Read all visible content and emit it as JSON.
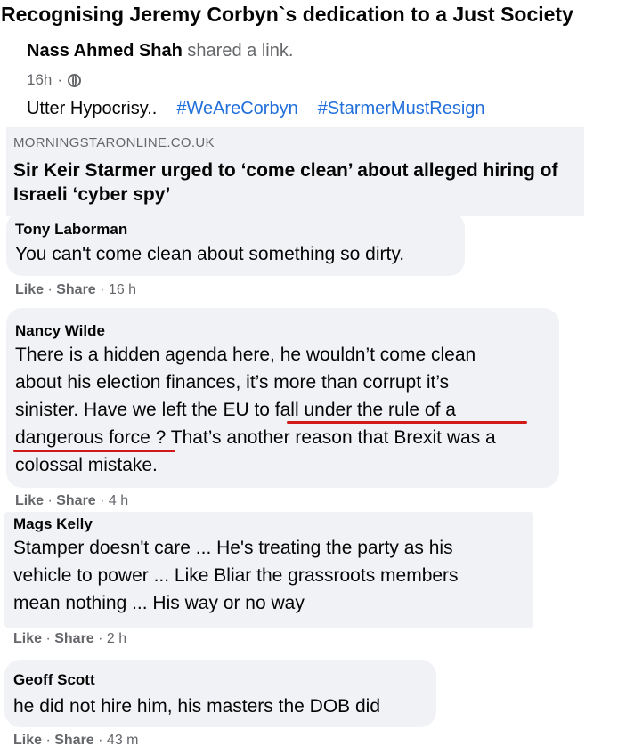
{
  "group": {
    "title": "Recognising Jeremy Corbyn`s dedication to a Just Society"
  },
  "post": {
    "author": "Nass Ahmed Shah",
    "action": " shared a link.",
    "time": "16h",
    "privacy_icon": "globe-icon",
    "text": "Utter Hypocrisy..",
    "hashtags": [
      "#WeAreCorbyn",
      "#StarmerMustResign"
    ],
    "link": {
      "domain": "MORNINGSTARONLINE.CO.UK",
      "title": "Sir Keir Starmer urged to ‘come clean’ about alleged hiring of Israeli ‘cyber spy’"
    }
  },
  "comments": [
    {
      "name": "Tony Laborman",
      "text": "You can't come clean about something so dirty.",
      "like": "Like",
      "share": "Share",
      "time": "16 h"
    },
    {
      "name": "Nancy Wilde",
      "lines": [
        "There is a hidden agenda here, he wouldn’t come clean",
        "about his election finances, it’s more than corrupt it’s",
        "sinister. Have we left the EU to fall under the rule of a",
        "dangerous force ? That’s another reason that Brexit was a",
        "colossal mistake."
      ],
      "like": "Like",
      "share": "Share",
      "time": "4 h"
    },
    {
      "name": "Mags Kelly",
      "lines": [
        "Stamper doesn't care ... He's treating the party as his",
        "vehicle to power ... Like Bliar the grassroots members",
        "mean nothing ... His way or no way"
      ],
      "like": "Like",
      "share": "Share",
      "time": "2 h"
    },
    {
      "name": "Geoff Scott",
      "text": "he did not hire him, his masters the DOB did",
      "like": "Like",
      "share": "Share",
      "time": "43 m"
    }
  ],
  "colors": {
    "hashtag": "#216fdb",
    "annotation": "#d21919",
    "bubble": "#f0f2f5",
    "secondary": "#65676b"
  }
}
